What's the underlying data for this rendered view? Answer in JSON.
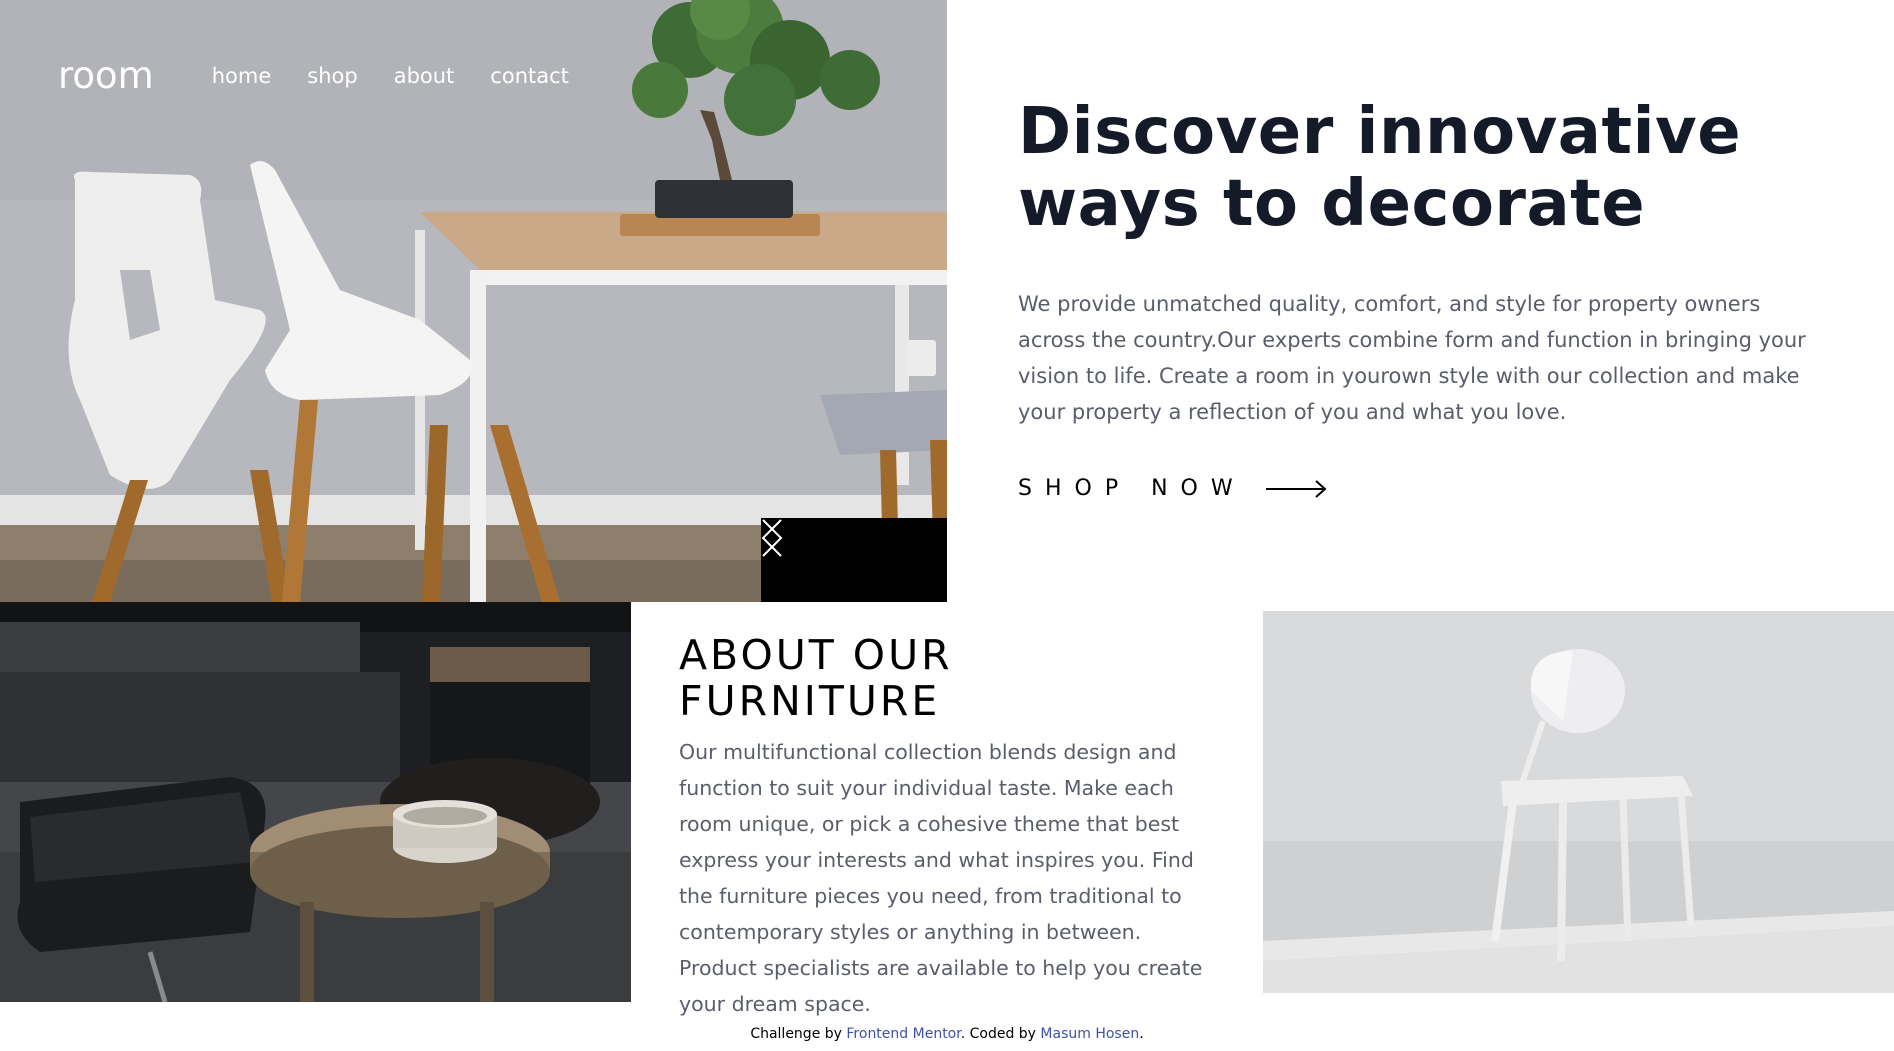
{
  "nav": {
    "logo": "room",
    "links": [
      "home",
      "shop",
      "about",
      "contact"
    ]
  },
  "hero": {
    "title": "Discover innovative ways to decorate",
    "description": "We provide unmatched quality, comfort, and style for property owners across the country.Our experts combine form and function in bringing your vision to life. Create a room in yourown style with our collection and make your property a reflection of you and what you love.",
    "cta_label": "SHOP NOW",
    "cta_icon": "arrow-right-icon",
    "slider": {
      "prev_icon": "angle-left-icon",
      "next_icon": "angle-right-icon"
    }
  },
  "about": {
    "title": "ABOUT OUR FURNITURE",
    "description": "Our multifunctional collection blends design and function to suit your individual taste. Make each room unique, or pick a cohesive theme that best express your interests and what inspires you. Find the furniture pieces you need, from traditional to contemporary styles or anything in between. Product specialists are available to help you create your dream space."
  },
  "footer": {
    "prefix": "Challenge by",
    "link1": "Frontend Mentor",
    "middle": ". Coded by",
    "link2": "Masum Hosen",
    "suffix": "."
  },
  "colors": {
    "heading": "#141a28",
    "body_text": "#5a5e6a",
    "link": "#3e52a3",
    "slider_bg": "#000000"
  }
}
